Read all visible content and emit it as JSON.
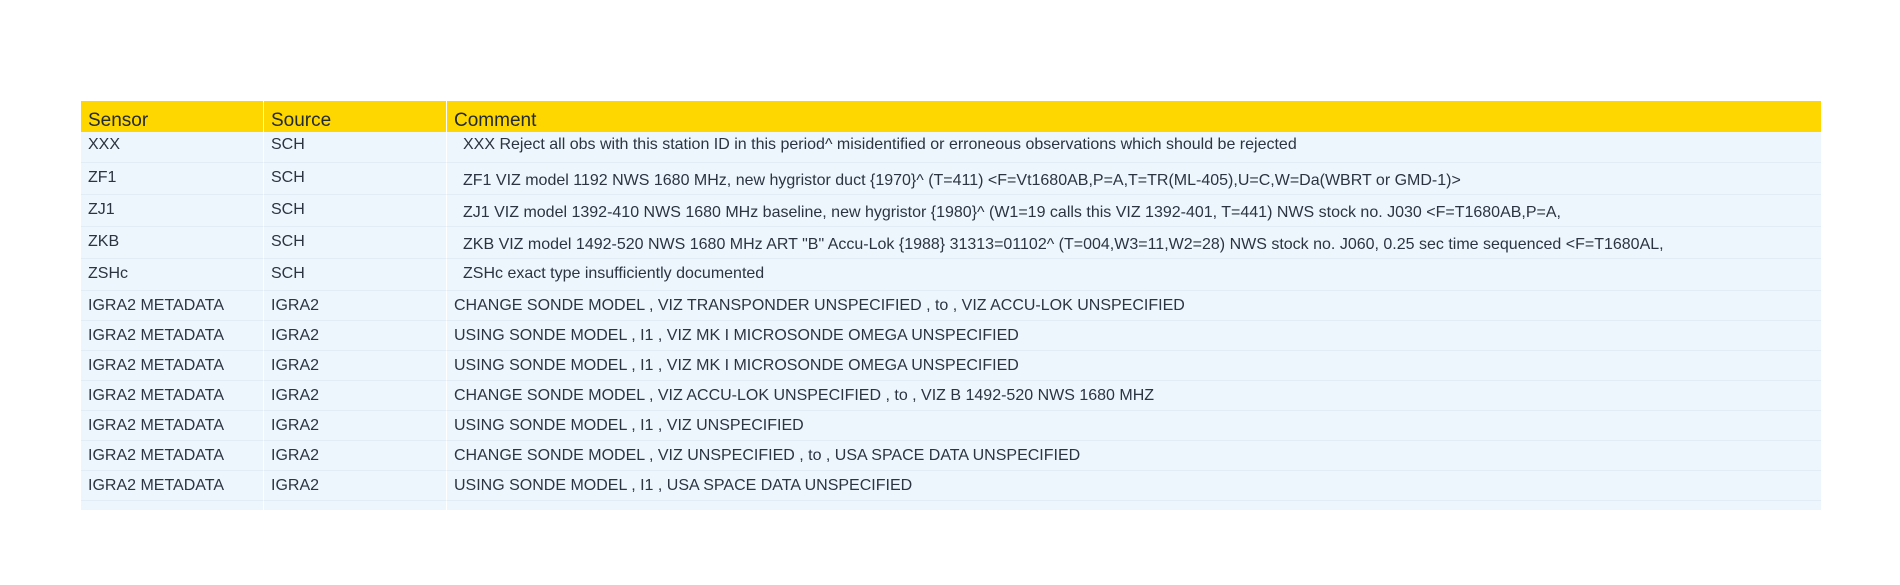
{
  "table": {
    "headers": [
      "Sensor",
      "Source",
      "Comment"
    ],
    "rows": [
      {
        "sensor": "XXX",
        "source": "SCH",
        "comment": "XXX Reject all obs with this station ID in this period^ misidentified or erroneous observations which should be rejected"
      },
      {
        "sensor": "ZF1",
        "source": "SCH",
        "comment": "ZF1 VIZ model 1192 NWS 1680 MHz, new hygristor duct {1970}^ (T=411) <F=Vt1680AB,P=A,T=TR(ML-405),U=C,W=Da(WBRT or GMD-1)>"
      },
      {
        "sensor": "ZJ1",
        "source": "SCH",
        "comment": "ZJ1 VIZ model 1392-410 NWS 1680 MHz baseline, new hygristor {1980}^ (W1=19 calls this VIZ 1392-401, T=441) NWS stock no. J030 <F=T1680AB,P=A,"
      },
      {
        "sensor": "ZKB",
        "source": "SCH",
        "comment": "ZKB VIZ model 1492-520 NWS 1680 MHz ART \"B\" Accu-Lok {1988} 31313=01102^ (T=004,W3=11,W2=28) NWS stock no. J060, 0.25 sec time sequenced <F=T1680AL,"
      },
      {
        "sensor": "ZSHc",
        "source": "SCH",
        "comment": "ZSHc exact type insufficiently documented"
      },
      {
        "sensor": "IGRA2 METADATA",
        "source": "IGRA2",
        "comment": "CHANGE SONDE MODEL , VIZ TRANSPONDER UNSPECIFIED , to , VIZ ACCU-LOK UNSPECIFIED"
      },
      {
        "sensor": "IGRA2 METADATA",
        "source": "IGRA2",
        "comment": "USING SONDE MODEL , I1 , VIZ MK I MICROSONDE OMEGA UNSPECIFIED"
      },
      {
        "sensor": "IGRA2 METADATA",
        "source": "IGRA2",
        "comment": "USING SONDE MODEL , I1 , VIZ MK I MICROSONDE OMEGA UNSPECIFIED"
      },
      {
        "sensor": "IGRA2 METADATA",
        "source": "IGRA2",
        "comment": "CHANGE SONDE MODEL , VIZ ACCU-LOK UNSPECIFIED , to , VIZ B 1492-520 NWS 1680 MHZ"
      },
      {
        "sensor": "IGRA2 METADATA",
        "source": "IGRA2",
        "comment": "USING SONDE MODEL , I1 , VIZ UNSPECIFIED"
      },
      {
        "sensor": "IGRA2 METADATA",
        "source": "IGRA2",
        "comment": "CHANGE SONDE MODEL , VIZ UNSPECIFIED , to , USA SPACE DATA UNSPECIFIED"
      },
      {
        "sensor": "IGRA2 METADATA",
        "source": "IGRA2",
        "comment": "USING SONDE MODEL , I1 , USA SPACE DATA UNSPECIFIED"
      }
    ]
  },
  "colors": {
    "header_bg": "#ffd700",
    "row_bg": "#eef6fd",
    "text": "#2b3440"
  }
}
